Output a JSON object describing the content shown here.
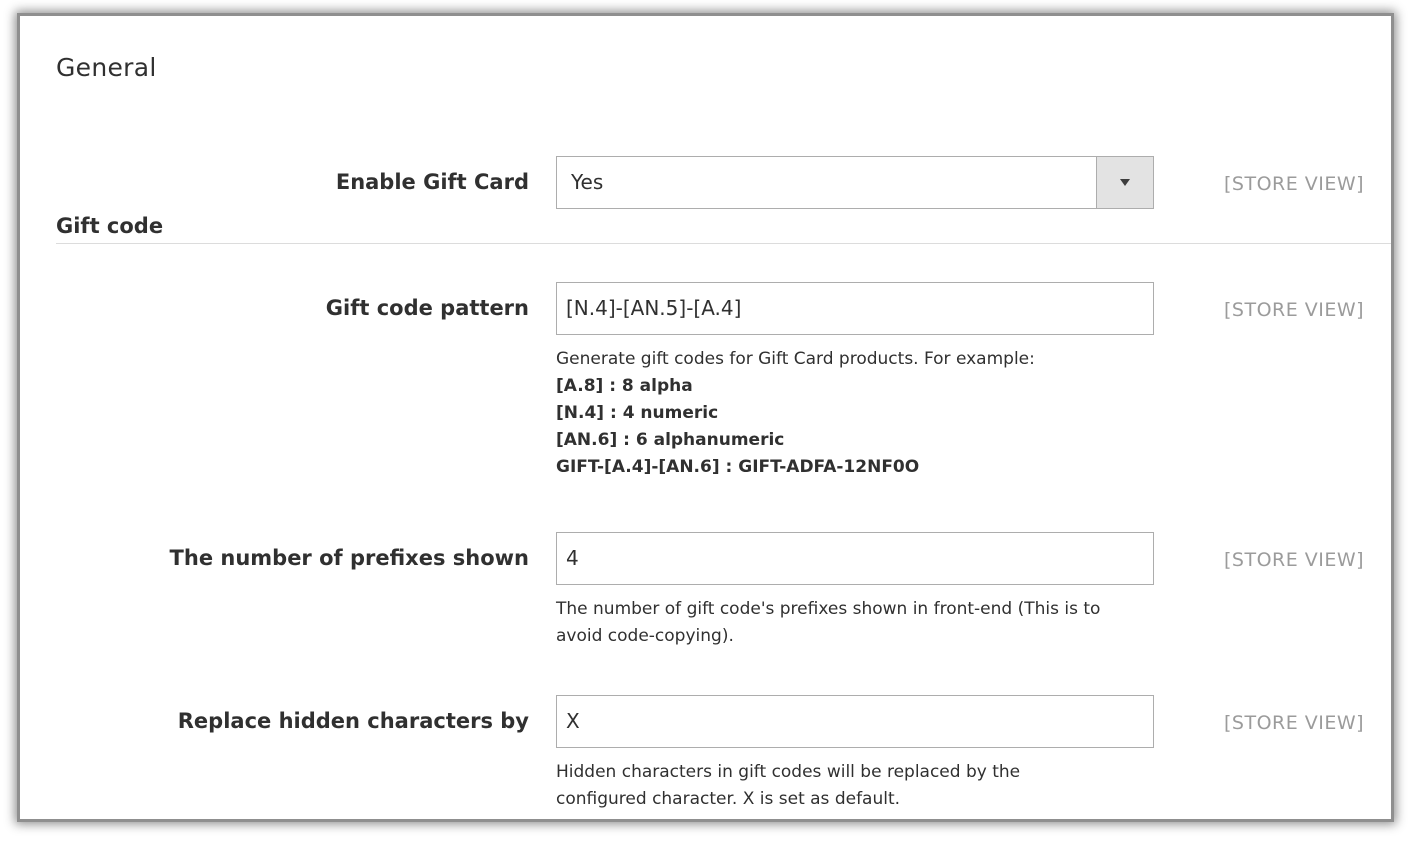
{
  "section": {
    "title": "General"
  },
  "group": {
    "title": "Gift code"
  },
  "fields": {
    "enable_gift_card": {
      "label": "Enable Gift Card",
      "value": "Yes",
      "scope": "[STORE VIEW]"
    },
    "gift_code_pattern": {
      "label": "Gift code pattern",
      "value": "[N.4]-[AN.5]-[A.4]",
      "scope": "[STORE VIEW]",
      "note_intro": "Generate gift codes for Gift Card products. For example:",
      "examples": [
        "[A.8] : 8 alpha",
        "[N.4] : 4 numeric",
        "[AN.6] : 6 alphanumeric",
        "GIFT-[A.4]-[AN.6] : GIFT-ADFA-12NF0O"
      ]
    },
    "prefixes_shown": {
      "label": "The number of prefixes shown",
      "value": "4",
      "scope": "[STORE VIEW]",
      "note_line1": "The number of gift code's prefixes shown in front-end (This is to",
      "note_line2": "avoid code-copying)."
    },
    "replace_hidden": {
      "label": "Replace hidden characters by",
      "value": "X",
      "scope": "[STORE VIEW]",
      "note_line1": "Hidden characters in gift codes will be replaced by the",
      "note_line2": "configured character. X is set as default."
    }
  },
  "icons": {
    "dropdown": "caret-down-icon"
  }
}
